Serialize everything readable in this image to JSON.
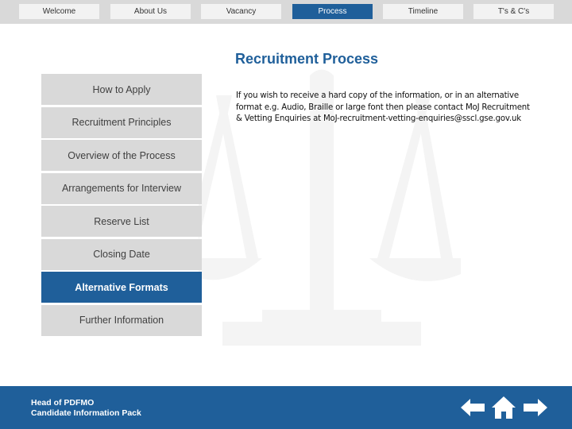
{
  "topnav": {
    "tabs": [
      {
        "label": "Welcome",
        "active": false
      },
      {
        "label": "About Us",
        "active": false
      },
      {
        "label": "Vacancy",
        "active": false
      },
      {
        "label": "Process",
        "active": true
      },
      {
        "label": "Timeline",
        "active": false
      },
      {
        "label": "T's & C's",
        "active": false
      }
    ]
  },
  "main": {
    "title": "Recruitment Process",
    "body": "If you wish to receive a hard copy of the information, or in an alternative format e.g. Audio, Braille or large font then please contact MoJ Recruitment & Vetting Enquiries at MoJ-recruitment-vetting-enquiries@sscl.gse.gov.uk",
    "watermark_icon": "scales-of-justice-icon"
  },
  "sidemenu": {
    "items": [
      {
        "label": "How to Apply",
        "active": false
      },
      {
        "label": "Recruitment Principles",
        "active": false
      },
      {
        "label": "Overview of the Process",
        "active": false
      },
      {
        "label": "Arrangements for Interview",
        "active": false
      },
      {
        "label": "Reserve List",
        "active": false
      },
      {
        "label": "Closing Date",
        "active": false
      },
      {
        "label": "Alternative Formats",
        "active": true
      },
      {
        "label": "Further Information",
        "active": false
      }
    ]
  },
  "footer": {
    "line1": "Head of PDFMO",
    "line2": "Candidate Information Pack",
    "icons": [
      "arrow-left-icon",
      "home-icon",
      "arrow-right-icon"
    ]
  },
  "colors": {
    "brand_blue": "#1f5f9a",
    "nav_bg": "#d9d9d9",
    "tab_bg": "#f2f2f2"
  }
}
